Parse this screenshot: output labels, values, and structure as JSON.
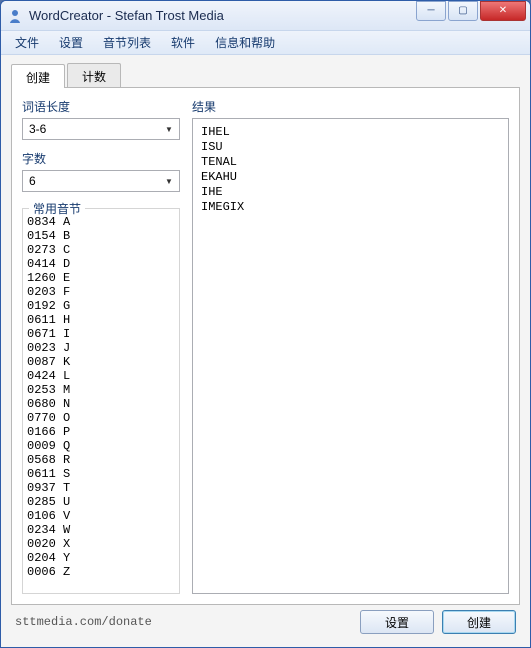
{
  "window": {
    "title": "WordCreator - Stefan Trost Media"
  },
  "menu": {
    "items": [
      "文件",
      "设置",
      "音节列表",
      "软件",
      "信息和帮助"
    ]
  },
  "tabs": {
    "items": [
      {
        "label": "创建",
        "active": true
      },
      {
        "label": "计数",
        "active": false
      }
    ]
  },
  "left": {
    "wordlen_label": "词语长度",
    "wordlen_value": "3-6",
    "count_label": "字数",
    "count_value": "6",
    "syllable_legend": "常用音节",
    "syllables": [
      {
        "n": "0834",
        "c": "A"
      },
      {
        "n": "0154",
        "c": "B"
      },
      {
        "n": "0273",
        "c": "C"
      },
      {
        "n": "0414",
        "c": "D"
      },
      {
        "n": "1260",
        "c": "E"
      },
      {
        "n": "0203",
        "c": "F"
      },
      {
        "n": "0192",
        "c": "G"
      },
      {
        "n": "0611",
        "c": "H"
      },
      {
        "n": "0671",
        "c": "I"
      },
      {
        "n": "0023",
        "c": "J"
      },
      {
        "n": "0087",
        "c": "K"
      },
      {
        "n": "0424",
        "c": "L"
      },
      {
        "n": "0253",
        "c": "M"
      },
      {
        "n": "0680",
        "c": "N"
      },
      {
        "n": "0770",
        "c": "O"
      },
      {
        "n": "0166",
        "c": "P"
      },
      {
        "n": "0009",
        "c": "Q"
      },
      {
        "n": "0568",
        "c": "R"
      },
      {
        "n": "0611",
        "c": "S"
      },
      {
        "n": "0937",
        "c": "T"
      },
      {
        "n": "0285",
        "c": "U"
      },
      {
        "n": "0106",
        "c": "V"
      },
      {
        "n": "0234",
        "c": "W"
      },
      {
        "n": "0020",
        "c": "X"
      },
      {
        "n": "0204",
        "c": "Y"
      },
      {
        "n": "0006",
        "c": "Z"
      }
    ]
  },
  "right": {
    "result_label": "结果",
    "results": [
      "IHEL",
      "ISU",
      "TENAL",
      "EKAHU",
      "IHE",
      "IMEGIX"
    ]
  },
  "footer": {
    "donate": "sttmedia.com/donate",
    "settings_btn": "设置",
    "create_btn": "创建"
  }
}
